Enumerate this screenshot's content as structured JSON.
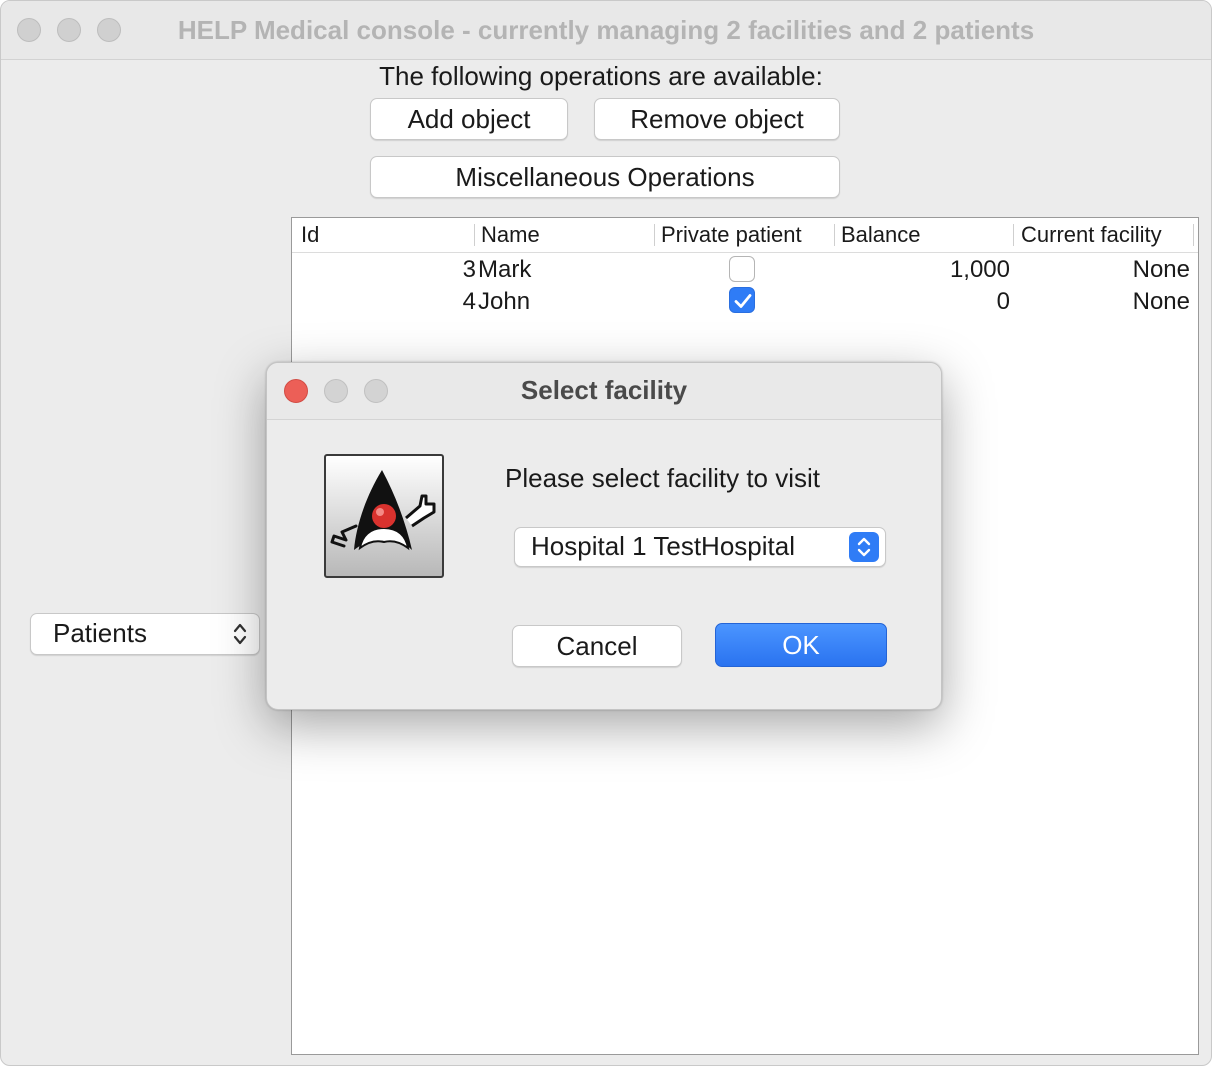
{
  "window": {
    "title": "HELP Medical console - currently managing 2 facilities and 2 patients"
  },
  "operations": {
    "label": "The following operations are available:",
    "add_label": "Add object",
    "remove_label": "Remove object",
    "misc_label": "Miscellaneous Operations"
  },
  "type_selector": {
    "value": "Patients"
  },
  "table": {
    "columns": [
      "Id",
      "Name",
      "Private patient",
      "Balance",
      "Current facility"
    ],
    "rows": [
      {
        "id": "3",
        "name": "Mark",
        "private": false,
        "balance": "1,000",
        "facility": "None"
      },
      {
        "id": "4",
        "name": "John",
        "private": true,
        "balance": "0",
        "facility": "None"
      }
    ]
  },
  "dialog": {
    "title": "Select facility",
    "prompt": "Please select facility to visit",
    "facility_select": "Hospital 1 TestHospital",
    "cancel_label": "Cancel",
    "ok_label": "OK",
    "icon": "java-duke-icon"
  },
  "colors": {
    "accent": "#2f7cf6",
    "close_red": "#ec5f57"
  }
}
